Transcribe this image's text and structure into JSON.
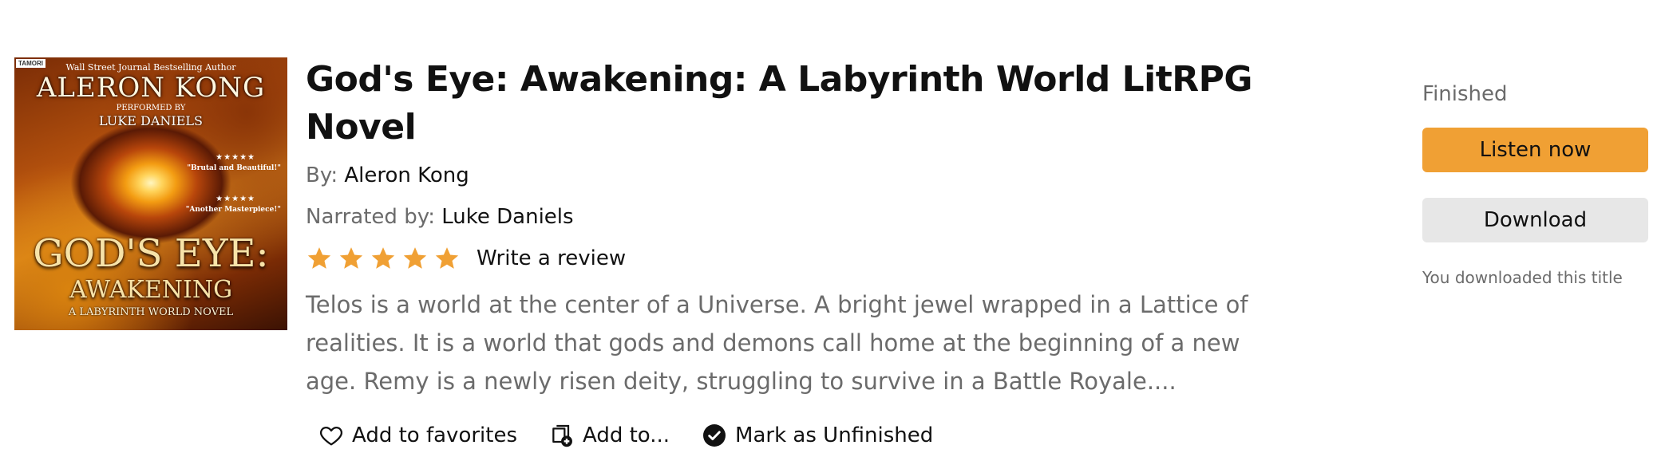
{
  "cover": {
    "badge": "TAMORI",
    "tagline": "Wall Street Journal Bestselling Author",
    "author": "ALERON KONG",
    "performed_by": "PERFORMED BY",
    "narrator": "LUKE DANIELS",
    "stars1": "★★★★★",
    "quote1": "\"Brutal and Beautiful!\"",
    "stars2": "★★★★★",
    "quote2": "\"Another Masterpiece!\"",
    "title": "GOD'S EYE:",
    "subtitle": "AWAKENING",
    "series": "A LABYRINTH WORLD NOVEL"
  },
  "book": {
    "title": "God's Eye: Awakening: A Labyrinth World LitRPG Novel",
    "by_label": "By:",
    "author": "Aleron Kong",
    "narrated_label": "Narrated by:",
    "narrator": "Luke Daniels",
    "rating_stars": 5,
    "write_review": "Write a review",
    "summary": "Telos is a world at the center of a Universe. A bright jewel wrapped in a Lattice of realities. It is a world that gods and demons call home at the beginning of a new age. Remy is a newly risen deity, struggling to survive in a Battle Royale...."
  },
  "actions": {
    "favorites": "Add to favorites",
    "add_to": "Add to...",
    "mark": "Mark as Unfinished"
  },
  "side": {
    "status": "Finished",
    "listen": "Listen now",
    "download": "Download",
    "note": "You downloaded this title"
  },
  "colors": {
    "accent": "#f0a034",
    "star": "#f0a034",
    "muted": "#6b6b6b"
  },
  "icons": [
    "heart-icon",
    "library-add-icon",
    "check-circle-icon",
    "star-icon"
  ]
}
